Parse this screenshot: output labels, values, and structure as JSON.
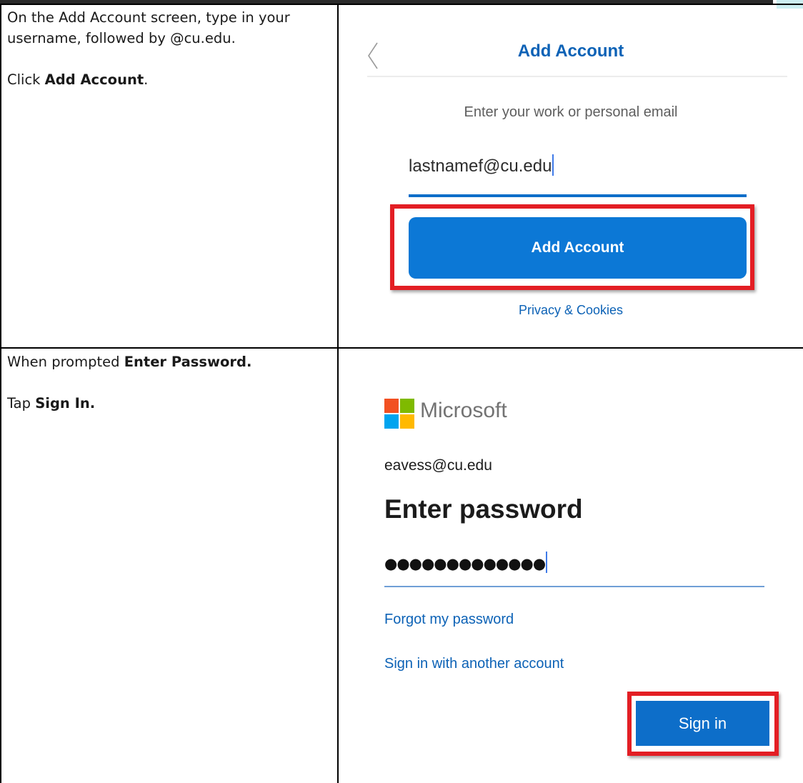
{
  "rows": [
    {
      "instructions": {
        "line1": "On the Add Account screen, type in your username, followed by @cu.edu.",
        "line2_prefix": "Click ",
        "line2_bold": "Add Account",
        "line2_suffix": "."
      },
      "screenshot": {
        "title": "Add Account",
        "prompt": "Enter your work or personal email",
        "email_value": "lastnamef@cu.edu",
        "button_label": "Add Account",
        "privacy_link": "Privacy & Cookies",
        "icons": {
          "back": "chevron-left-icon"
        },
        "colors": {
          "accent": "#0c78d6",
          "highlight": "#e31e24"
        }
      }
    },
    {
      "instructions": {
        "line1_prefix": "When prompted ",
        "line1_bold": "Enter Password.",
        "line2_prefix": "Tap ",
        "line2_bold": "Sign In."
      },
      "screenshot": {
        "brand": "Microsoft",
        "account_email": "eavess@cu.edu",
        "heading": "Enter password",
        "password_mask": "●●●●●●●●●●●●●",
        "forgot_link": "Forgot my password",
        "other_account_link": "Sign in with another account",
        "signin_label": "Sign in",
        "icons": {
          "logo": "microsoft-logo-icon"
        },
        "colors": {
          "logo": [
            "#f25022",
            "#7fba00",
            "#00a4ef",
            "#ffb900"
          ],
          "button": "#0d6ec9"
        }
      }
    }
  ]
}
